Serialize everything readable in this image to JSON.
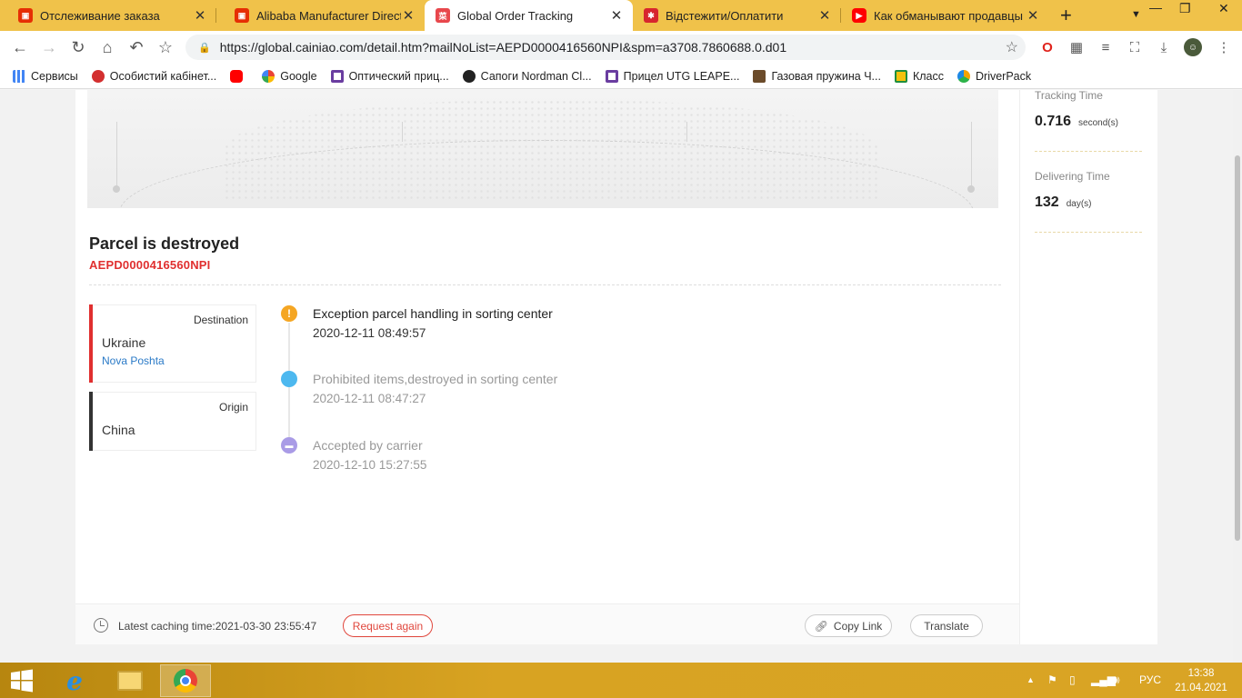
{
  "browser": {
    "tabs": [
      {
        "title": "Отслеживание заказа",
        "icon": "aliexpress-icon",
        "color": "#e62e04",
        "active": false
      },
      {
        "title": "Alibaba Manufacturer Directory",
        "icon": "aliexpress-icon",
        "color": "#e62e04",
        "active": false
      },
      {
        "title": "Global Order Tracking",
        "icon": "cainiao-icon",
        "color": "#e8474c",
        "active": true
      },
      {
        "title": "Відстежити/Оплатити",
        "icon": "novaposhta-icon",
        "color": "#d7262e",
        "active": false
      },
      {
        "title": "Как обманывают продавцы на",
        "icon": "youtube-icon",
        "color": "#ff0000",
        "active": false
      }
    ],
    "new_tab": "+",
    "url": "https://global.cainiao.com/detail.htm?mailNoList=AEPD0000416560NPI&spm=a3708.7860688.0.d01",
    "bookmarks": [
      {
        "label": "Сервисы",
        "icon": "apps-grid-icon",
        "color": "#4285f4"
      },
      {
        "label": "Особистий кабінет...",
        "icon": "bookmark-red-icon",
        "color": "#d32f2f"
      },
      {
        "label": "",
        "icon": "youtube-icon",
        "color": "#ff0000"
      },
      {
        "label": "Google",
        "icon": "google-icon",
        "color": "#4285f4"
      },
      {
        "label": "Оптический приц...",
        "icon": "bookmark-purple-icon",
        "color": "#6a3da0"
      },
      {
        "label": "Сапоги Nordman Cl...",
        "icon": "bookmark-black-icon",
        "color": "#222222"
      },
      {
        "label": "Прицел UTG LEAPE...",
        "icon": "bookmark-purple-icon",
        "color": "#6a3da0"
      },
      {
        "label": "Газовая пружина Ч...",
        "icon": "bookmark-brown-icon",
        "color": "#6b4b2a"
      },
      {
        "label": "Класс",
        "icon": "classroom-icon",
        "color": "#1e8e3e"
      },
      {
        "label": "DriverPack",
        "icon": "driverpack-icon",
        "color": "#f4a300"
      }
    ]
  },
  "parcel": {
    "status_title": "Parcel is destroyed",
    "tracking_number": "AEPD0000416560NPI",
    "destination": {
      "label": "Destination",
      "country": "Ukraine",
      "carrier": "Nova Poshta",
      "color": "#e02f2f"
    },
    "origin": {
      "label": "Origin",
      "country": "China",
      "color": "#333333"
    },
    "events": [
      {
        "title": "Exception parcel handling in sorting center",
        "time": "2020-12-11 08:49:57",
        "icon": "warning-icon",
        "color": "#f5a623"
      },
      {
        "title": "Prohibited items,destroyed in sorting center",
        "time": "2020-12-11 08:47:27",
        "icon": "dot-icon",
        "color": "#4db8ef"
      },
      {
        "title": "Accepted by carrier",
        "time": "2020-12-10 15:27:55",
        "icon": "truck-icon",
        "color": "#a99be6"
      }
    ]
  },
  "footer": {
    "cache_text": "Latest caching time:2021-03-30 23:55:47",
    "request_again": "Request again",
    "copy_link": "Copy Link",
    "translate": "Translate"
  },
  "stats": {
    "tracking_time_label": "Tracking Time",
    "tracking_time_value": "0.716",
    "tracking_time_unit": "second(s)",
    "delivering_time_label": "Delivering Time",
    "delivering_time_value": "132",
    "delivering_time_unit": "day(s)"
  },
  "taskbar": {
    "lang": "РУС",
    "time": "13:38",
    "date": "21.04.2021"
  }
}
